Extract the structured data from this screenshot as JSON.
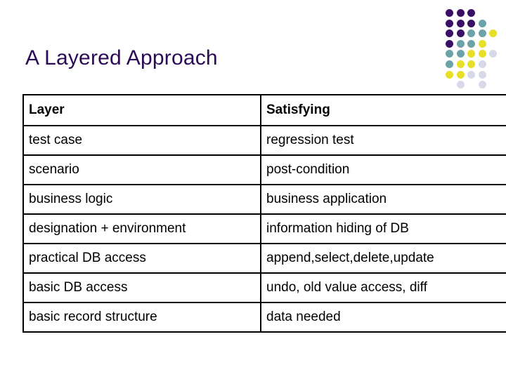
{
  "slide": {
    "title": "A Layered Approach"
  },
  "decoration": {
    "name": "dot-grid-motif",
    "rule_color": "#1a1a1a",
    "colors": {
      "purple": "#3b0f66",
      "teal": "#6ca3a8",
      "yellow": "#e8e026",
      "gray": "#d6d9e8"
    },
    "grid": [
      [
        "purple",
        "purple",
        "purple",
        null,
        null
      ],
      [
        "purple",
        "purple",
        "purple",
        "teal",
        null
      ],
      [
        "purple",
        "purple",
        "teal",
        "teal",
        "yellow"
      ],
      [
        "purple",
        "teal",
        "teal",
        "yellow",
        null
      ],
      [
        "teal",
        "teal",
        "yellow",
        "yellow",
        "gray"
      ],
      [
        "teal",
        "yellow",
        "yellow",
        "gray",
        null
      ],
      [
        "yellow",
        "yellow",
        "gray",
        "gray",
        null
      ],
      [
        null,
        "gray",
        null,
        "gray",
        null
      ]
    ]
  },
  "table": {
    "headers": [
      "Layer",
      "Satisfying"
    ],
    "rows": [
      [
        "test case",
        "regression test"
      ],
      [
        "scenario",
        "post-condition"
      ],
      [
        "business logic",
        "business application"
      ],
      [
        "designation + environment",
        "information hiding of DB"
      ],
      [
        "practical DB access",
        "append,select,delete,update"
      ],
      [
        "basic DB access",
        "undo, old value access, diff"
      ],
      [
        "basic record structure",
        "data needed"
      ]
    ]
  }
}
